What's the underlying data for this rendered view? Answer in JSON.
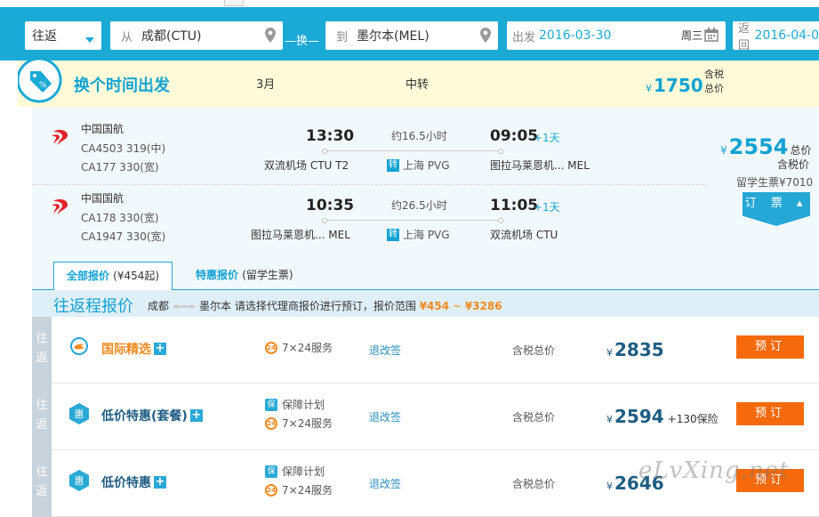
{
  "search": {
    "trip_type": "往返",
    "from_prefix": "从",
    "from_value": "成都(CTU)",
    "swap_label": "—换—",
    "to_prefix": "到",
    "to_value": "墨尔本(MEL)",
    "depart_prefix": "出发",
    "depart_date": "2016-03-30",
    "depart_weekday": "周三",
    "return_prefix": "返回",
    "return_date": "2016-04-0"
  },
  "banner": {
    "title": "换个时间出发",
    "month": "3月",
    "transfer": "中转",
    "price_currency": "¥",
    "price": "1750",
    "tax_line1": "含税",
    "tax_line2": "总价"
  },
  "flights": [
    {
      "airline": "中国国航",
      "codes": [
        "CA4503 319(中)",
        "CA177 330(宽)"
      ],
      "dep_time": "13:30",
      "dep_airport": "双流机场 CTU T2",
      "duration": "约16.5小时",
      "transfer_badge": "转",
      "transfer_city": "上海 PVG",
      "arr_time": "09:05",
      "arr_plus": "+1天",
      "arr_airport": "图拉马莱恩机... MEL"
    },
    {
      "airline": "中国国航",
      "codes": [
        "CA178 330(宽)",
        "CA1947 330(宽)"
      ],
      "dep_time": "10:35",
      "dep_airport": "图拉马莱恩机... MEL",
      "duration": "约26.5小时",
      "transfer_badge": "转",
      "transfer_city": "上海 PVG",
      "arr_time": "11:05",
      "arr_plus": "+1天",
      "arr_airport": "双流机场 CTU"
    }
  ],
  "total": {
    "currency": "¥",
    "price": "2554",
    "price_label": "总价",
    "tax_label": "含税价",
    "student_label": "留学生票¥7010",
    "book_label": "订 票 ▴"
  },
  "tabs": {
    "all_label": "全部报价",
    "all_note": "(¥454起)",
    "special_label": "特惠报价",
    "special_note": "(留学生票)"
  },
  "fare_header": {
    "title": "往返程报价",
    "from": "成都",
    "to": "墨尔本",
    "hint": "请选择代理商报价进行预订，报价范围",
    "range_low": "¥454",
    "range_sep": "~",
    "range_high": "¥3286"
  },
  "fares": [
    {
      "side": "往返",
      "name": "国际精选",
      "plus": "+",
      "services": [
        "7×24服务"
      ],
      "refund": "退改签",
      "tax": "含税总价",
      "currency": "¥",
      "price": "2835",
      "insurance": "",
      "order": "预订"
    },
    {
      "side": "往返",
      "name": "低价特惠(套餐)",
      "plus": "+",
      "services": [
        "保障计划",
        "7×24服务"
      ],
      "refund": "退改签",
      "tax": "含税总价",
      "currency": "¥",
      "price": "2594",
      "insurance": "+130保险",
      "order": "预订"
    },
    {
      "side": "往返",
      "name": "低价特惠",
      "plus": "+",
      "services": [
        "保障计划",
        "7×24服务"
      ],
      "refund": "退改签",
      "tax": "含税总价",
      "currency": "¥",
      "price": "2646",
      "insurance": "",
      "order": "预订"
    }
  ],
  "icons": {
    "service_24": "24",
    "guarantee": "保",
    "hui": "惠"
  },
  "watermark": "eLvXing.net",
  "colors": {
    "brand_blue": "#1ba9d6",
    "order_orange": "#f46a0c",
    "range_orange": "#f18a1f"
  }
}
